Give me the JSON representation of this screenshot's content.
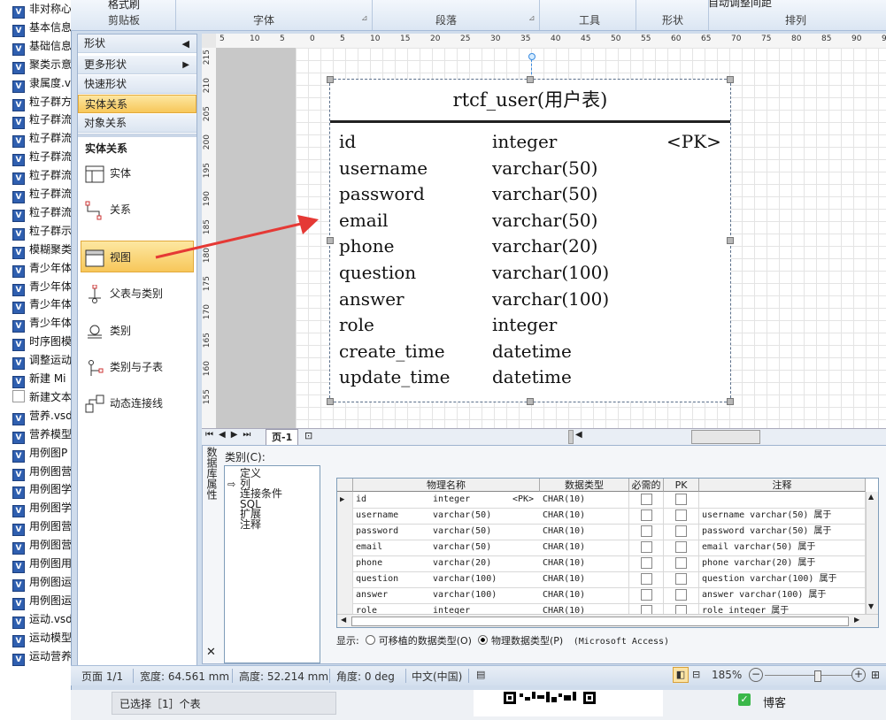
{
  "explorer": {
    "files": [
      {
        "label": "非对称心",
        "type": "doc"
      },
      {
        "label": "基本信息",
        "type": "doc"
      },
      {
        "label": "基础信息",
        "type": "doc"
      },
      {
        "label": "聚类示意",
        "type": "doc"
      },
      {
        "label": "隶属度.v",
        "type": "doc"
      },
      {
        "label": "粒子群方",
        "type": "doc"
      },
      {
        "label": "粒子群流",
        "type": "doc"
      },
      {
        "label": "粒子群流",
        "type": "doc"
      },
      {
        "label": "粒子群流",
        "type": "doc"
      },
      {
        "label": "粒子群流",
        "type": "doc"
      },
      {
        "label": "粒子群流",
        "type": "doc"
      },
      {
        "label": "粒子群流",
        "type": "doc"
      },
      {
        "label": "粒子群示",
        "type": "doc"
      },
      {
        "label": "模糊聚类",
        "type": "doc"
      },
      {
        "label": "青少年体",
        "type": "doc"
      },
      {
        "label": "青少年体",
        "type": "doc"
      },
      {
        "label": "青少年体",
        "type": "doc"
      },
      {
        "label": "青少年体",
        "type": "doc"
      },
      {
        "label": "时序图模",
        "type": "doc"
      },
      {
        "label": "调整运动",
        "type": "doc"
      },
      {
        "label": "新建 Mi",
        "type": "doc"
      },
      {
        "label": "新建文本",
        "type": "txt"
      },
      {
        "label": "营养.vsd",
        "type": "doc"
      },
      {
        "label": "营养模型",
        "type": "doc"
      },
      {
        "label": "用例图P",
        "type": "doc"
      },
      {
        "label": "用例图营",
        "type": "doc"
      },
      {
        "label": "用例图学",
        "type": "doc"
      },
      {
        "label": "用例图学",
        "type": "doc"
      },
      {
        "label": "用例图营",
        "type": "doc"
      },
      {
        "label": "用例图营",
        "type": "doc"
      },
      {
        "label": "用例图用",
        "type": "doc"
      },
      {
        "label": "用例图运",
        "type": "doc"
      },
      {
        "label": "用例图运",
        "type": "doc"
      },
      {
        "label": "运动.vsd",
        "type": "doc"
      },
      {
        "label": "运动模型",
        "type": "doc"
      },
      {
        "label": "运动营养",
        "type": "doc"
      }
    ]
  },
  "ribbon": {
    "top_button": "格式刷",
    "top_right": "自动调整间距",
    "groups": [
      "剪贴板",
      "字体",
      "段落",
      "工具",
      "形状",
      "排列"
    ]
  },
  "shapes_panel": {
    "header": "形状",
    "more_shapes": "更多形状",
    "quick_shapes": "快速形状",
    "entity_relation": "实体关系",
    "object_relation": "对象关系",
    "section_title": "实体关系",
    "items": [
      "实体",
      "关系",
      "视图",
      "父表与类别",
      "类别",
      "类别与子表",
      "动态连接线"
    ]
  },
  "ruler": {
    "top": [
      "5",
      "10",
      "5",
      "0",
      "5",
      "10",
      "15",
      "20",
      "25",
      "30",
      "35",
      "40",
      "45",
      "50",
      "55",
      "60",
      "65",
      "70",
      "75",
      "80",
      "85",
      "90",
      "95"
    ],
    "left": [
      "215",
      "210",
      "205",
      "200",
      "195",
      "190",
      "185",
      "180",
      "175",
      "170",
      "165",
      "160",
      "155"
    ]
  },
  "entity": {
    "title": "rtcf_user(用户表)",
    "pk_marker": "<PK>",
    "fields": [
      {
        "name": "id",
        "type": "integer"
      },
      {
        "name": "username",
        "type": "varchar(50)"
      },
      {
        "name": "password",
        "type": "varchar(50)"
      },
      {
        "name": "email",
        "type": "varchar(50)"
      },
      {
        "name": "phone",
        "type": "varchar(20)"
      },
      {
        "name": "question",
        "type": "varchar(100)"
      },
      {
        "name": "answer",
        "type": "varchar(100)"
      },
      {
        "name": "role",
        "type": "integer"
      },
      {
        "name": "create_time",
        "type": "datetime"
      },
      {
        "name": "update_time",
        "type": "datetime"
      }
    ]
  },
  "page_tabs": {
    "current": "页-1"
  },
  "db_props": {
    "vertical_title": "数据库属性",
    "category_label": "类别(C):",
    "categories": [
      "定义",
      "列",
      "连接条件",
      "SQL",
      "扩展",
      "注释"
    ],
    "selected_category": "列",
    "columns": [
      "物理名称",
      "数据类型",
      "必需的",
      "PK",
      "注释"
    ],
    "rows": [
      {
        "name": "id",
        "type": "integer",
        "pk": "<PK>",
        "dtype": "CHAR(10)",
        "note": ""
      },
      {
        "name": "username",
        "type": "varchar(50)",
        "pk": "",
        "dtype": "CHAR(10)",
        "note": "username    varchar(50) 属于"
      },
      {
        "name": "password",
        "type": "varchar(50)",
        "pk": "",
        "dtype": "CHAR(10)",
        "note": "password    varchar(50) 属于"
      },
      {
        "name": "email",
        "type": "varchar(50)",
        "pk": "",
        "dtype": "CHAR(10)",
        "note": "email       varchar(50) 属于"
      },
      {
        "name": "phone",
        "type": "varchar(20)",
        "pk": "",
        "dtype": "CHAR(10)",
        "note": "phone       varchar(20) 属于"
      },
      {
        "name": "question",
        "type": "varchar(100)",
        "pk": "",
        "dtype": "CHAR(10)",
        "note": "question    varchar(100) 属于"
      },
      {
        "name": "answer",
        "type": "varchar(100)",
        "pk": "",
        "dtype": "CHAR(10)",
        "note": "answer      varchar(100) 属于"
      },
      {
        "name": "role",
        "type": "integer",
        "pk": "",
        "dtype": "CHAR(10)",
        "note": "role      integer 属于"
      }
    ],
    "display_label": "显示:",
    "option_portable": "可移植的数据类型(O)",
    "option_physical": "物理数据类型(P)",
    "db_name": "(Microsoft Access)"
  },
  "status": {
    "page": "页面 1/1",
    "width": "宽度: 64.561 mm",
    "height": "高度: 52.214 mm",
    "angle": "角度: 0 deg",
    "lang": "中文(中国)",
    "zoom": "185%"
  },
  "taskbar": {
    "selection": "已选择［1］个表",
    "blog": "博客"
  },
  "colors": {
    "accent": "#f7c75a",
    "arrow": "#e53935"
  }
}
